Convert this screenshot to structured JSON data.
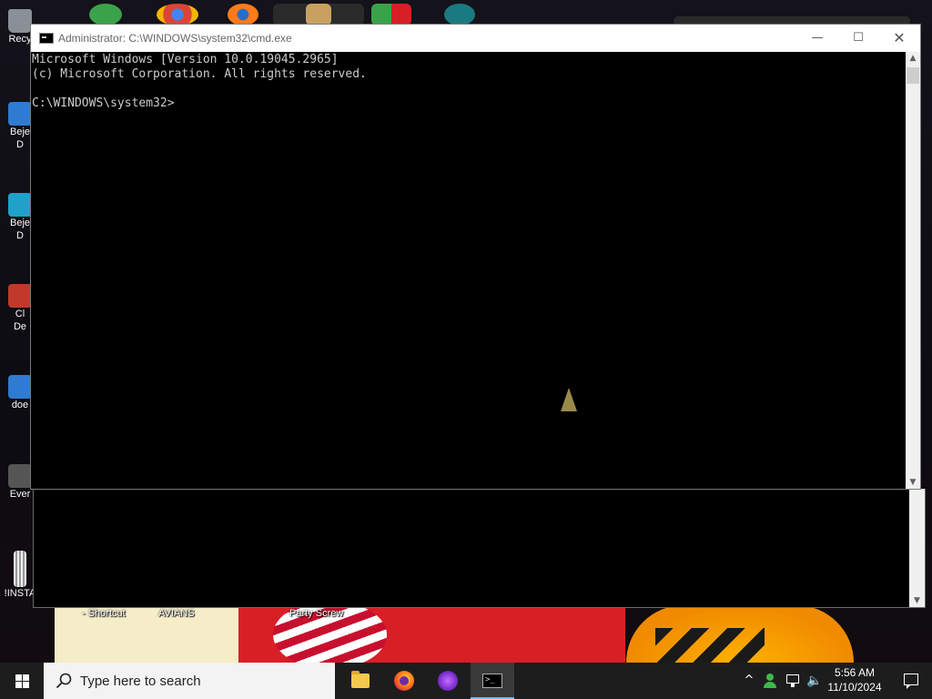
{
  "window": {
    "title": "Administrator: C:\\WINDOWS\\system32\\cmd.exe",
    "minimize_label": "—",
    "maximize_label": "☐",
    "close_label": "✕"
  },
  "console": {
    "lines": [
      "Microsoft Windows [Version 10.0.19045.2965]",
      "(c) Microsoft Corporation. All rights reserved.",
      "",
      "C:\\WINDOWS\\system32>"
    ]
  },
  "desktop": {
    "icons": [
      {
        "label": "Recy",
        "color": "#8a8f98"
      },
      {
        "label": "Beje",
        "sub": "D",
        "color": "#2e7bd1"
      },
      {
        "label": "Beje",
        "sub": "D",
        "color": "#1fa1c9"
      },
      {
        "label": "Cl",
        "sub": "De",
        "color": "#c0392b"
      },
      {
        "label": "doe",
        "color": "#2e7bd1"
      },
      {
        "label": "Ever",
        "color": "#555555"
      },
      {
        "label": "!INSTA",
        "color": "#cccccc"
      }
    ],
    "overlay_labels": {
      "shortcut": "- Shortcut",
      "avians": "AVIANS",
      "party": "Party Screw"
    }
  },
  "taskbar": {
    "search_placeholder": "Type here to search",
    "apps": [
      "file-explorer",
      "firefox",
      "tor-browser",
      "command-prompt"
    ],
    "active_app": "command-prompt",
    "chevron": "^",
    "volume": "🔈",
    "time": "5:56 AM",
    "date": "11/10/2024"
  },
  "colors": {
    "console_bg": "#000000",
    "console_text": "#cccccc",
    "taskbar_bg": "#1d1d1d",
    "active_accent": "#76b9ed"
  }
}
